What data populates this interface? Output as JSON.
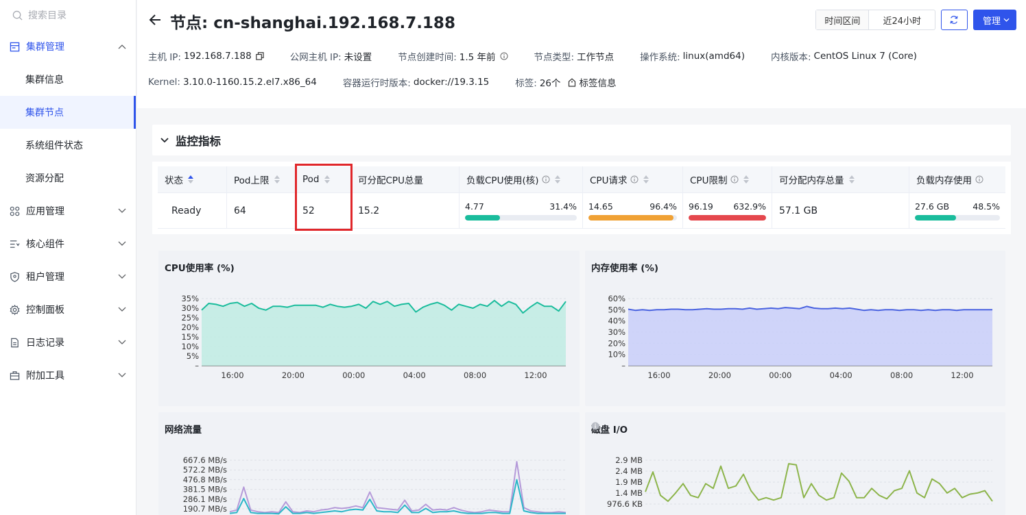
{
  "sidebar": {
    "search_placeholder": "搜索目录",
    "groups": [
      {
        "label": "集群管理",
        "icon": "cluster-icon",
        "expanded": true,
        "children": [
          "集群信息",
          "集群节点",
          "系统组件状态",
          "资源分配"
        ]
      },
      {
        "label": "应用管理",
        "icon": "apps-icon"
      },
      {
        "label": "核心组件",
        "icon": "components-icon"
      },
      {
        "label": "租户管理",
        "icon": "tenant-icon"
      },
      {
        "label": "控制面板",
        "icon": "gear-icon"
      },
      {
        "label": "日志记录",
        "icon": "log-icon"
      },
      {
        "label": "附加工具",
        "icon": "toolbox-icon"
      }
    ],
    "active_child": "集群节点"
  },
  "header": {
    "title": "节点: cn-shanghai.192.168.7.188",
    "time_range_label": "时间区间",
    "time_range_value": "近24小时",
    "manage_label": "管理",
    "info": {
      "host_ip_k": "主机 IP:",
      "host_ip_v": "192.168.7.188",
      "public_ip_k": "公网主机 IP:",
      "public_ip_v": "未设置",
      "created_k": "节点创建时间:",
      "created_v": "1.5 年前",
      "type_k": "节点类型:",
      "type_v": "工作节点",
      "os_k": "操作系统:",
      "os_v": "linux(amd64)",
      "kernel_ver_k": "内核版本:",
      "kernel_ver_v": "CentOS Linux 7 (Core)",
      "kernel_k": "Kernel:",
      "kernel_v": "3.10.0-1160.15.2.el7.x86_64",
      "runtime_k": "容器运行时版本:",
      "runtime_v": "docker://19.3.15",
      "labels_k": "标签:",
      "labels_v": "26个",
      "labels_link": "标签信息"
    }
  },
  "section_title": "监控指标",
  "metrics_table": {
    "headers": [
      "状态",
      "Pod上限",
      "Pod",
      "可分配CPU总量",
      "负载CPU使用(核)",
      "CPU请求",
      "CPU限制",
      "可分配内存总量",
      "负载内存使用"
    ],
    "row": {
      "status": "Ready",
      "pod_limit": "64",
      "pod": "52",
      "cpu_alloc": "15.2",
      "cpu_usage": "4.77",
      "cpu_usage_pct": "31.4%",
      "cpu_usage_frac": 0.314,
      "cpu_usage_color": "#1abc9c",
      "cpu_req": "14.65",
      "cpu_req_pct": "96.4%",
      "cpu_req_frac": 0.964,
      "cpu_req_color": "#f0a134",
      "cpu_lim": "96.19",
      "cpu_lim_pct": "632.9%",
      "cpu_lim_frac": 1.0,
      "cpu_lim_color": "#e5474d",
      "mem_alloc": "57.1 GB",
      "mem_usage": "27.6 GB",
      "mem_usage_pct": "48.5%",
      "mem_usage_frac": 0.485,
      "mem_usage_color": "#1abc9c"
    }
  },
  "chart_data": [
    {
      "type": "area",
      "title": "CPU使用率 (%)",
      "x_ticks": [
        "16:00",
        "20:00",
        "00:00",
        "04:00",
        "08:00",
        "12:00"
      ],
      "y_ticks": [
        "35%",
        "30%",
        "25%",
        "20%",
        "15%",
        "10%",
        "5%",
        "–"
      ],
      "ylim": [
        0,
        35
      ],
      "color": "#1abc9c",
      "fill": "#bfece3",
      "values": [
        29,
        32.5,
        32,
        31,
        32.5,
        33,
        31,
        32.5,
        30,
        29,
        31,
        31,
        30.5,
        31.5,
        31.5,
        31.5,
        31.5,
        30.5,
        32,
        31,
        30.5,
        31,
        32,
        30,
        33.5,
        32,
        33.5,
        31,
        32,
        32.5,
        28,
        30.5,
        32,
        33,
        31.5,
        29,
        32,
        31,
        30,
        32,
        31,
        34,
        31,
        33.5,
        32,
        27.5,
        30.5,
        33,
        31,
        31,
        28.5,
        33.5
      ]
    },
    {
      "type": "area",
      "title": "内存使用率 (%)",
      "x_ticks": [
        "16:00",
        "20:00",
        "00:00",
        "04:00",
        "08:00",
        "12:00"
      ],
      "y_ticks": [
        "60%",
        "50%",
        "40%",
        "30%",
        "20%",
        "10%",
        "–"
      ],
      "ylim": [
        0,
        60
      ],
      "color": "#4a63e0",
      "fill": "#c9cff9",
      "values": [
        50.5,
        49.5,
        50,
        49.5,
        50,
        50,
        50.5,
        50.5,
        50,
        50,
        50.5,
        51,
        50.5,
        50.5,
        51,
        51,
        50.5,
        51.5,
        50.5,
        51,
        51.5,
        51,
        52,
        51.5,
        51,
        53,
        51.5,
        51,
        51,
        51.5,
        51,
        51.5,
        50.5,
        49.5,
        50,
        49.5,
        50,
        50,
        49.5,
        50,
        50,
        49.5,
        50,
        49.5,
        50,
        50,
        49.5,
        50,
        50,
        50,
        50,
        50
      ]
    },
    {
      "type": "line",
      "title": "网络流量",
      "y_ticks": [
        "667.6 MB/s",
        "572.2 MB/s",
        "476.8 MB/s",
        "381.5 MB/s",
        "286.1 MB/s",
        "190.7 MB/s"
      ],
      "series": [
        {
          "color": "#b59ad9",
          "values": [
            40,
            60,
            340,
            60,
            40,
            30,
            40,
            30,
            160,
            40,
            30,
            50,
            40,
            60,
            70,
            90,
            80,
            90,
            110,
            90,
            280,
            90,
            80,
            70,
            60,
            180,
            50,
            60,
            130,
            60,
            70,
            60,
            90,
            60,
            40,
            30,
            40,
            60,
            50,
            40,
            40,
            650,
            90,
            50,
            40,
            30,
            30,
            40,
            30
          ]
        },
        {
          "color": "#2bb6c8",
          "values": [
            20,
            30,
            200,
            30,
            20,
            20,
            20,
            15,
            100,
            20,
            20,
            30,
            20,
            30,
            40,
            50,
            40,
            60,
            70,
            60,
            190,
            50,
            40,
            40,
            30,
            120,
            30,
            30,
            80,
            30,
            40,
            40,
            50,
            30,
            20,
            20,
            20,
            30,
            30,
            20,
            20,
            430,
            50,
            30,
            20,
            20,
            20,
            20,
            20
          ]
        }
      ]
    },
    {
      "type": "line",
      "title": "磁盘 I/O",
      "y_ticks": [
        "2.9 MB",
        "2.4 MB",
        "1.9 MB",
        "1.4 MB",
        "976.6 KB"
      ],
      "series": [
        {
          "color": "#8cb44a",
          "values": [
            1.55,
            2.4,
            1.4,
            1.15,
            1.5,
            1.9,
            1.4,
            1.3,
            1.9,
            1.7,
            2.65,
            1.7,
            1.8,
            2.3,
            1.6,
            1.2,
            1.3,
            1.2,
            1.3,
            2.75,
            2.7,
            1.3,
            1.9,
            1.4,
            1.2,
            1.3,
            2.35,
            2.0,
            1.3,
            1.3,
            1.7,
            1.4,
            1.25,
            1.6,
            1.7,
            2.45,
            1.5,
            1.3,
            2.1,
            1.9,
            1.5,
            1.7,
            1.3,
            1.45,
            1.5,
            1.6,
            1.15
          ]
        }
      ]
    }
  ]
}
